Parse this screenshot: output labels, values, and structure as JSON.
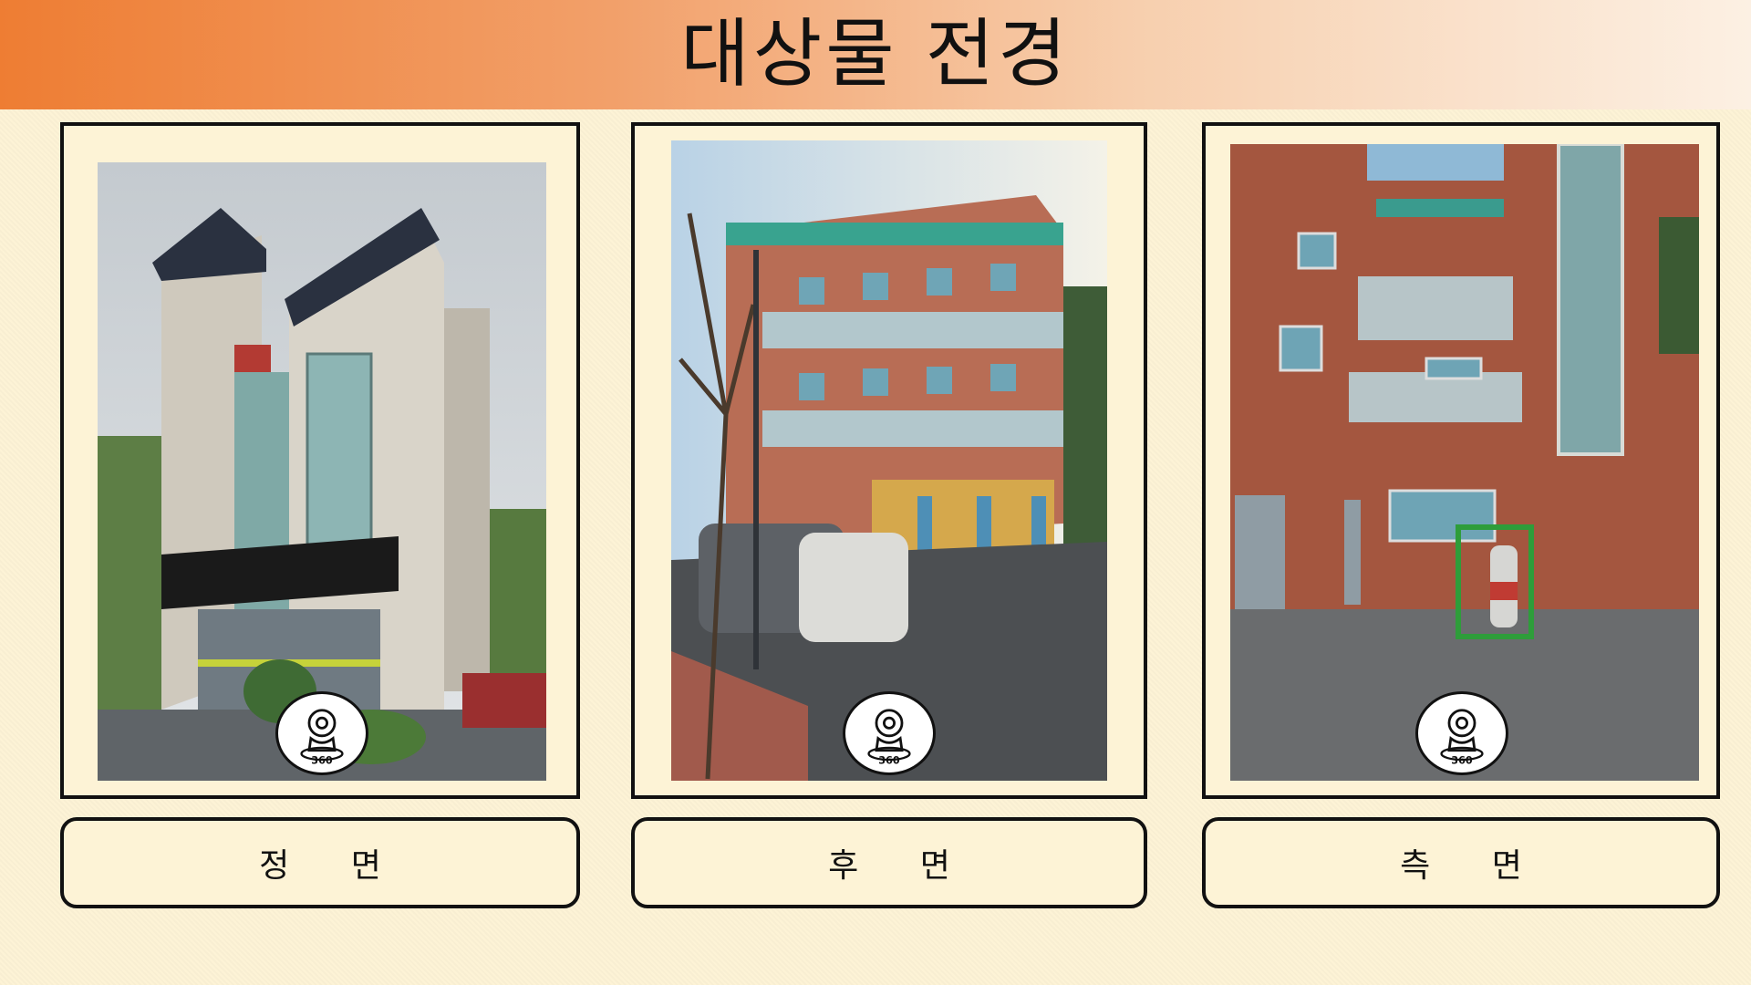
{
  "header": {
    "title": "대상물 전경"
  },
  "views": [
    {
      "label": "정 면",
      "badge_text": "360"
    },
    {
      "label": "후 면",
      "badge_text": "360"
    },
    {
      "label": "측 면",
      "badge_text": "360"
    }
  ],
  "colors": {
    "header_start": "#ee7d33",
    "background": "#fdf3d6",
    "border": "#111111"
  }
}
